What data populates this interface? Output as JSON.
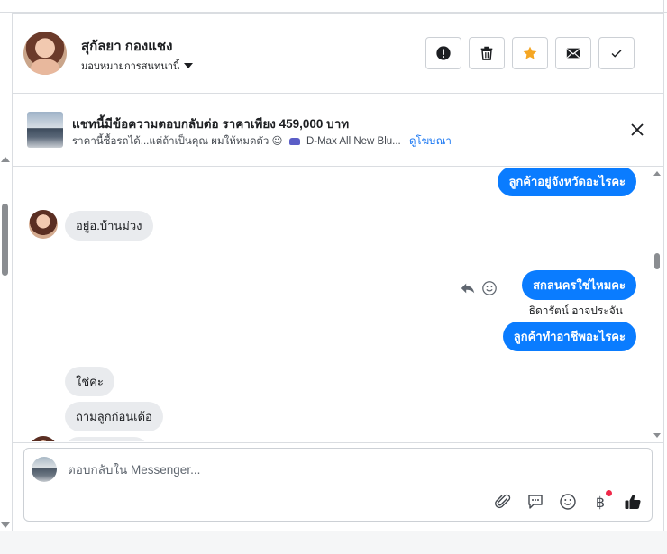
{
  "header": {
    "contact_name": "สุกัลยา กองแชง",
    "assign_label": "มอบหมายการสนทนานี้",
    "actions": [
      {
        "name": "report-button",
        "icon": "exclamation-icon"
      },
      {
        "name": "delete-button",
        "icon": "trash-icon"
      },
      {
        "name": "star-button",
        "icon": "star-icon",
        "color": "#f5a623"
      },
      {
        "name": "mark-unread-button",
        "icon": "envelope-icon"
      },
      {
        "name": "mark-done-button",
        "icon": "check-icon"
      }
    ]
  },
  "ad": {
    "title": "แชทนี้มีข้อความตอบกลับต่อ ราคาเพียง 459,000 บาท",
    "snippet": "ราคานี้ซื้อรถได้...แต่ถ้าเป็นคุณ ผมให้หมดตัว 😉",
    "car_text": "D-Max All New Blu...",
    "view_ad_link": "ดูโฆษณา"
  },
  "messages": {
    "out_1": "ลูกค้าอยู่จังหวัดอะไรคะ",
    "in_1": "อยู่อ.บ้านม่วง",
    "out_2": "สกลนครใช่ไหมคะ",
    "sender_name": "ธิดารัตน์ อาจประจัน",
    "out_3": "ลูกค้าทำอาชีพอะไรคะ",
    "in_2": "ใช่ค่ะ",
    "in_3": "ถามลูกก่อนเด้อ"
  },
  "composer": {
    "placeholder": "ตอบกลับใน Messenger..."
  },
  "colors": {
    "outgoing_bubble": "#0a7cff",
    "incoming_bubble": "#e9ebee",
    "accent_star": "#f5a623",
    "link": "#1876f2",
    "notification_dot": "#f02849"
  }
}
